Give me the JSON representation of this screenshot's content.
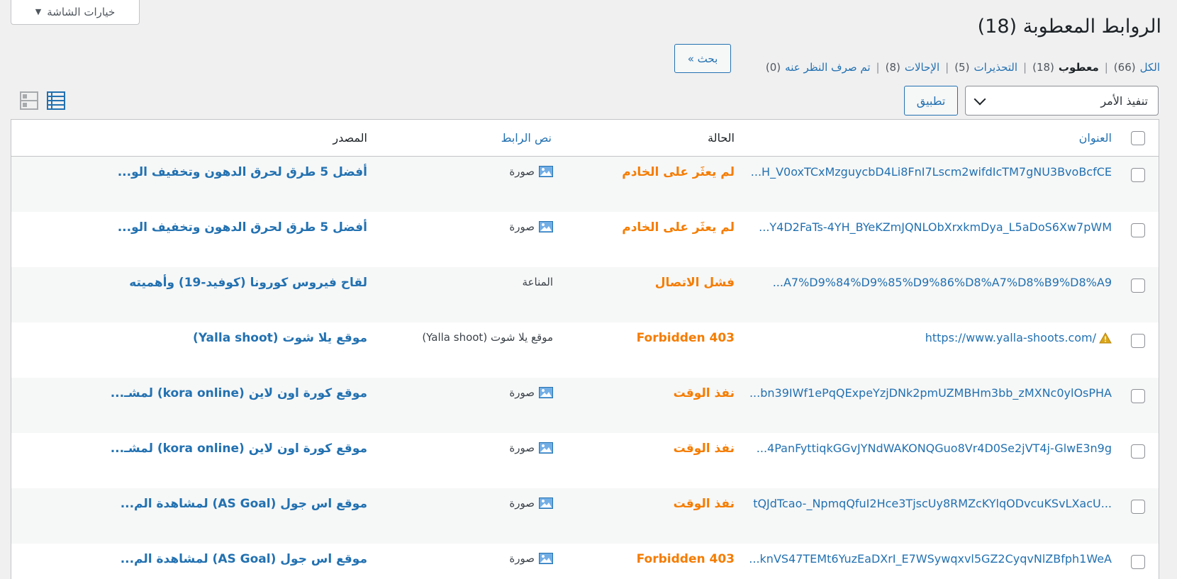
{
  "screen_options": {
    "label": "خيارات الشاشة",
    "caret": "▼"
  },
  "page_title": "الروابط المعطوبة (18)",
  "filters": [
    {
      "label": "الكل",
      "count": "(66)",
      "current": false
    },
    {
      "label": "معطوب",
      "count": "(18)",
      "current": true
    },
    {
      "label": "التحذيرات",
      "count": "(5)",
      "current": false
    },
    {
      "label": "الإحالات",
      "count": "(8)",
      "current": false
    },
    {
      "label": "تم صرف النظر عنه",
      "count": "(0)",
      "current": false
    }
  ],
  "separator": "|",
  "search_button": "بحث »",
  "bulk_action": {
    "selected": "تنفيذ الأمر",
    "apply": "تطبيق"
  },
  "view_modes": {
    "list": "list-view-icon",
    "excerpt": "excerpt-view-icon"
  },
  "colors": {
    "link": "#2271b1",
    "status": "#f57c00",
    "alt_row": "#f6f7f7"
  },
  "table": {
    "headers": {
      "title": "العنوان",
      "status": "الحالة",
      "text": "نص الرابط",
      "source": "المصدر"
    },
    "rows": [
      {
        "url": "...H_V0oxTCxMzguycbD4Li8FnI7Lscm2wifdIcTM7gNU3BvoBcfCE",
        "warning": false,
        "status": "لم يعثَر على الخادم",
        "text": "صورة",
        "has_image_icon": true,
        "source": "أفضل 5 طرق لحرق الدهون وتخفيف الو..."
      },
      {
        "url": "...Y4D2FaTs-4YH_BYeKZmJQNLObXrxkmDya_L5aDoS6Xw7pWM",
        "warning": false,
        "status": "لم يعثَر على الخادم",
        "text": "صورة",
        "has_image_icon": true,
        "source": "أفضل 5 طرق لحرق الدهون وتخفيف الو..."
      },
      {
        "url": "...A7%D9%84%D9%85%D9%86%D8%A7%D8%B9%D8%A9",
        "warning": false,
        "status": "فشل الاتصال",
        "text": "المناعة",
        "has_image_icon": false,
        "source": "لقاح فيروس كورونا (كوفيد-19) وأهميته"
      },
      {
        "url": "https://www.yalla-shoots.com/",
        "warning": true,
        "status": "403 Forbidden",
        "text": "موقع يلا شوت (Yalla shoot)",
        "has_image_icon": false,
        "source": "موقع يلا شوت (Yalla shoot)"
      },
      {
        "url": "...bn39IWf1ePqQExpeYzjDNk2pmUZMBHm3bb_zMXNc0ylOsPHA",
        "warning": false,
        "status": "نفذ الوقت",
        "text": "صورة",
        "has_image_icon": true,
        "source": "موقع كورة اون لاين (kora online) لمشـ..."
      },
      {
        "url": "...4PanFyttiqkGGvJYNdWAKONQGuo8Vr4D0Se2jVT4j-GlwE3n9g",
        "warning": false,
        "status": "نفذ الوقت",
        "text": "صورة",
        "has_image_icon": true,
        "source": "موقع كورة اون لاين (kora online) لمشـ..."
      },
      {
        "url": "tQJdTcao-_NpmqQfuI2Hce3TjscUy8RMZcKYlqODvcuKSvLXacU...",
        "warning": false,
        "status": "نفذ الوقت",
        "text": "صورة",
        "has_image_icon": true,
        "source": "موقع اس جول (AS Goal) لمشاهدة الم..."
      },
      {
        "url": "...knVS47TEMt6YuzEaDXrI_E7WSywqxvl5GZ2CyqvNlZBfph1WeA",
        "warning": false,
        "status": "403 Forbidden",
        "text": "صورة",
        "has_image_icon": true,
        "source": "موقع اس جول (AS Goal) لمشاهدة الم..."
      }
    ]
  }
}
